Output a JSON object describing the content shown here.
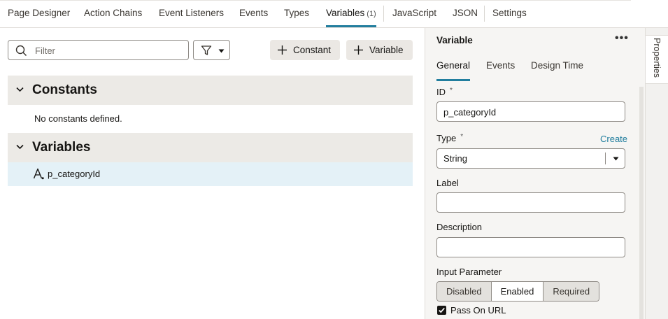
{
  "tabs": [
    {
      "label": "Page Designer"
    },
    {
      "label": "Action Chains"
    },
    {
      "label": "Event Listeners"
    },
    {
      "label": "Events"
    },
    {
      "label": "Types"
    },
    {
      "label": "Variables",
      "count": "(1)",
      "active": true
    },
    {
      "label": "JavaScript"
    },
    {
      "label": "JSON"
    },
    {
      "label": "Settings"
    }
  ],
  "toolbar": {
    "filter_placeholder": "Filter",
    "add_constant_label": "Constant",
    "add_variable_label": "Variable"
  },
  "constants": {
    "title": "Constants",
    "empty_message": "No constants defined."
  },
  "variables": {
    "title": "Variables",
    "items": [
      {
        "name": "p_categoryId",
        "icon": "string-type-icon"
      }
    ]
  },
  "properties": {
    "panel_title": "Variable",
    "more_label": "•••",
    "subtabs": [
      "General",
      "Events",
      "Design Time"
    ],
    "active_subtab": "General",
    "id_label": "ID",
    "required_marker": "*",
    "id_value": "p_categoryId",
    "type_label": "Type",
    "type_value": "String",
    "create_link": "Create",
    "label_label": "Label",
    "label_value": "",
    "description_label": "Description",
    "description_value": "",
    "input_parameter_label": "Input Parameter",
    "input_parameter_options": [
      "Disabled",
      "Enabled",
      "Required"
    ],
    "input_parameter_selected": "Enabled",
    "pass_on_url_label": "Pass On URL",
    "pass_on_url_checked": true
  },
  "side_tab": {
    "label": "Properties"
  },
  "colors": {
    "accent": "#227e9e",
    "selected_row": "#e4f1f7",
    "section_bg": "#eceae6"
  }
}
